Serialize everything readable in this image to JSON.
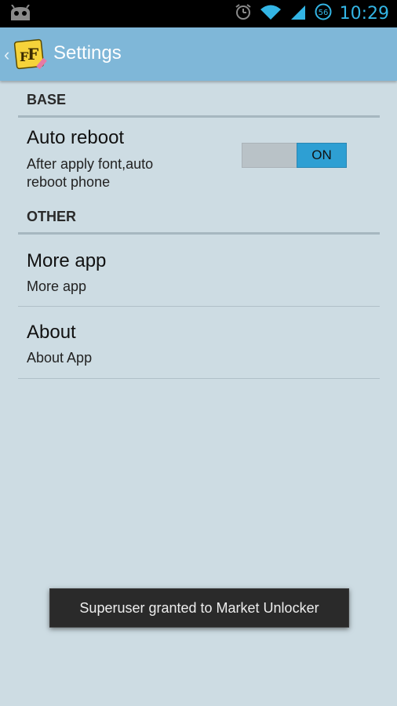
{
  "status_bar": {
    "time": "10:29",
    "network_badge": "56",
    "icons": [
      "cyanogenmod-android-icon",
      "alarm-icon",
      "wifi-icon",
      "signal-icon",
      "data-badge-icon"
    ]
  },
  "action_bar": {
    "title": "Settings",
    "up_icon": "chevron-left-icon",
    "logo": "font-app-logo"
  },
  "sections": [
    {
      "header": "BASE"
    },
    {
      "header": "OTHER"
    }
  ],
  "prefs": {
    "auto_reboot": {
      "title": "Auto reboot",
      "summary_line1": "After apply font,auto",
      "summary_line2": "reboot phone",
      "toggle_label": "ON"
    },
    "more_app": {
      "title": "More app",
      "summary": "More app"
    },
    "about": {
      "title": "About",
      "summary": "About App"
    }
  },
  "toast": {
    "message": "Superuser granted to Market Unlocker"
  },
  "colors": {
    "background": "#cddce3",
    "action_bar": "#7fb7d8",
    "accent": "#33b5e5",
    "toggle_on": "#2e9fd3"
  }
}
